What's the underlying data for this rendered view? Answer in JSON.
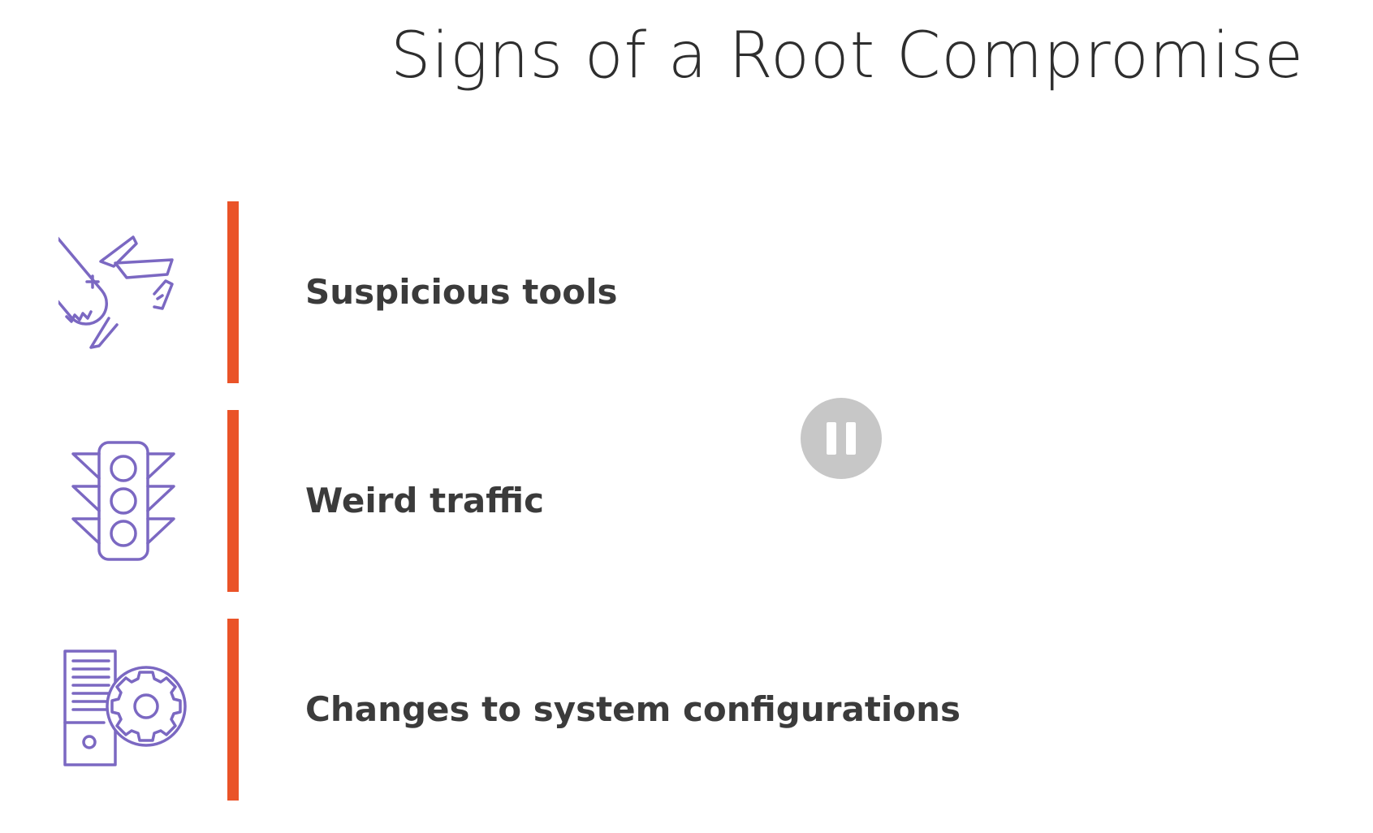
{
  "slide": {
    "title": "Signs of a Root Compromise"
  },
  "items": [
    {
      "label": "Suspicious tools",
      "icon": "swiss-army-knife-icon"
    },
    {
      "label": "Weird traffic",
      "icon": "traffic-light-icon"
    },
    {
      "label": "Changes to system configurations",
      "icon": "server-gear-icon"
    }
  ],
  "player": {
    "pause_icon": "pause-icon"
  },
  "colors": {
    "accent_bar": "#ea5328",
    "icon_stroke": "#7b68c2",
    "text": "#3b3b3b",
    "pause_bg": "#c7c7c7"
  }
}
